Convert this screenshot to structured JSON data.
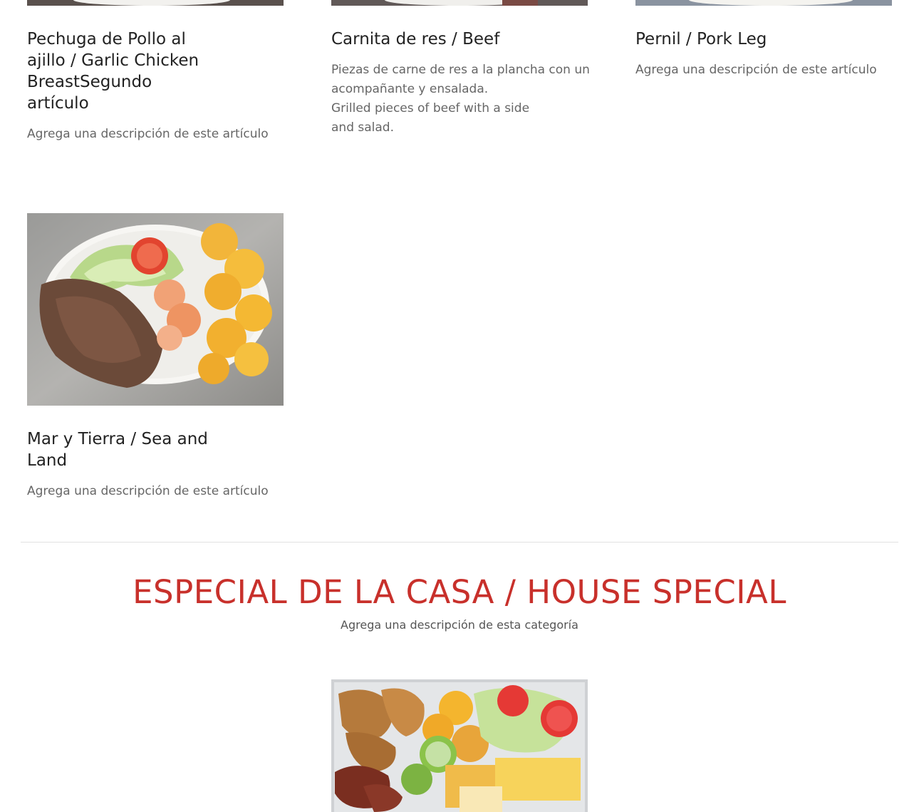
{
  "items_row1": [
    {
      "title": "Pechuga de Pollo al\najillo / Garlic Chicken\nBreastSegundo\nartículo",
      "description": "Agrega una descripción de este artículo",
      "image_icon": "plate-photo-icon"
    },
    {
      "title": "Carnita de res / Beef",
      "description": "Piezas de carne de res a la plancha con un\nacompañante y ensalada.\nGrilled pieces of beef with a side\nand salad.",
      "image_icon": "plate-photo-icon"
    },
    {
      "title": "Pernil / Pork Leg",
      "description": "Agrega una descripción de este artículo",
      "image_icon": "plate-photo-icon"
    }
  ],
  "items_row2": [
    {
      "title": "Mar y Tierra / Sea and\nLand",
      "description": "Agrega una descripción de este artículo",
      "image_icon": "surf-and-turf-photo-icon"
    }
  ],
  "category": {
    "title": "ESPECIAL DE LA CASA / HOUSE SPECIAL",
    "description": "Agrega una descripción de esta categoría",
    "item_image_icon": "house-special-platter-photo-icon"
  },
  "colors": {
    "category_title": "#c8302b",
    "item_title": "#222222",
    "item_description": "#666666"
  }
}
